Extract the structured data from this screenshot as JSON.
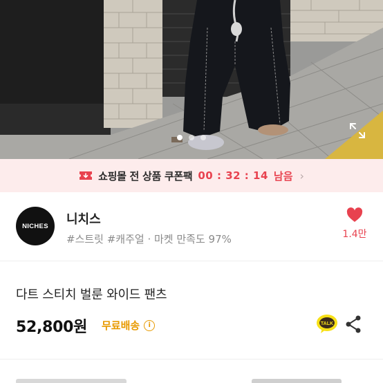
{
  "gallery": {
    "slide_count": 3,
    "active_slide": 1
  },
  "coupon": {
    "label": "쇼핑몰 전 상품 쿠폰팩",
    "timer": "00 : 32 : 14",
    "suffix": "남음",
    "chevron": "›",
    "accent_color": "#e8424f"
  },
  "shop": {
    "logo_text": "NICHES",
    "name": "니치스",
    "meta": "#스트릿 #캐주얼 · 마켓 만족도 97%",
    "favorite_count": "1.4만"
  },
  "product": {
    "title": "다트 스티치 벌룬 와이드 팬츠",
    "price": "52,800원",
    "shipping": "무료배송",
    "info_glyph": "i",
    "talk_label": "TALK"
  },
  "colors": {
    "shipping": "#e89a00",
    "heart": "#e8424f"
  }
}
